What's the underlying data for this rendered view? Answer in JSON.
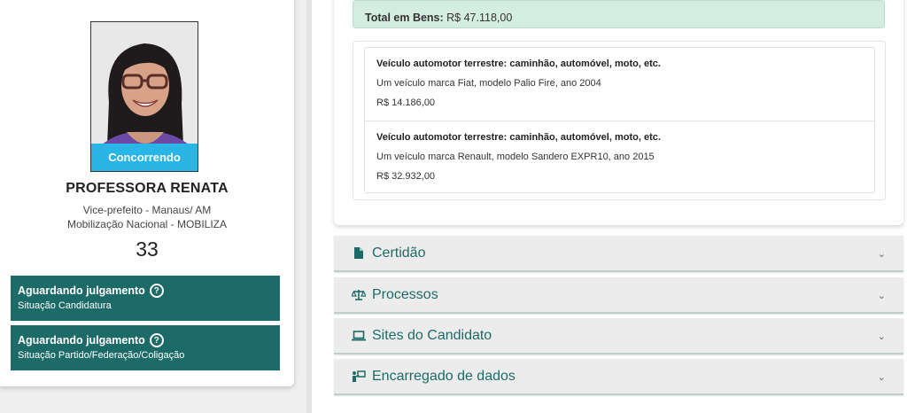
{
  "candidate": {
    "status": "Concorrendo",
    "name": "PROFESSORA RENATA",
    "office": "Vice-prefeito - Manaus/ AM",
    "party": "Mobilização Nacional - MOBILIZA",
    "number": "33"
  },
  "situations": [
    {
      "title": "Aguardando julgamento",
      "subtitle": "Situação Candidatura",
      "help_icon": "?"
    },
    {
      "title": "Aguardando julgamento",
      "subtitle": "Situação Partido/Federação/Coligação",
      "help_icon": "?"
    }
  ],
  "bens": {
    "total_label": "Total em Bens:",
    "total_value": "R$ 47.118,00",
    "items": [
      {
        "type": "Veículo automotor terrestre: caminhão, automóvel, moto, etc.",
        "description": "Um veículo marca Fiat, modelo Palio Fire, ano 2004",
        "value": "R$ 14.186,00"
      },
      {
        "type": "Veículo automotor terrestre: caminhão, automóvel, moto, etc.",
        "description": "Um veículo marca Renault, modelo Sandero EXPR10, ano 2015",
        "value": "R$ 32.932,00"
      }
    ]
  },
  "accordions": [
    {
      "label": "Certidão",
      "icon": "file-icon"
    },
    {
      "label": "Processos",
      "icon": "balance-scale-icon"
    },
    {
      "label": "Sites do Candidato",
      "icon": "laptop-icon"
    },
    {
      "label": "Encarregado de dados",
      "icon": "person-board-icon"
    }
  ],
  "colors": {
    "accent": "#1d6b68",
    "status_ribbon": "#29b6e6",
    "total_bg": "#d4ede1"
  }
}
